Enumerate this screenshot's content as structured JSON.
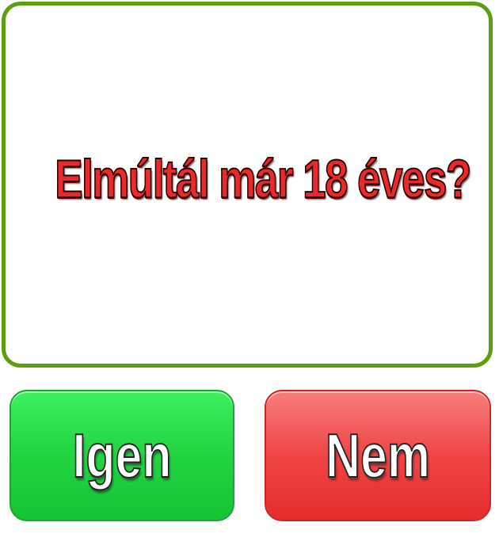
{
  "question": {
    "text": "Elmúltál már 18 éves?"
  },
  "buttons": {
    "yes_label": "Igen",
    "no_label": "Nem"
  },
  "colors": {
    "panel_border": "#5f9e12",
    "question_text": "#ea2a2a",
    "yes_button": "#22d442",
    "no_button": "#f04545",
    "button_text": "#ffffff"
  }
}
